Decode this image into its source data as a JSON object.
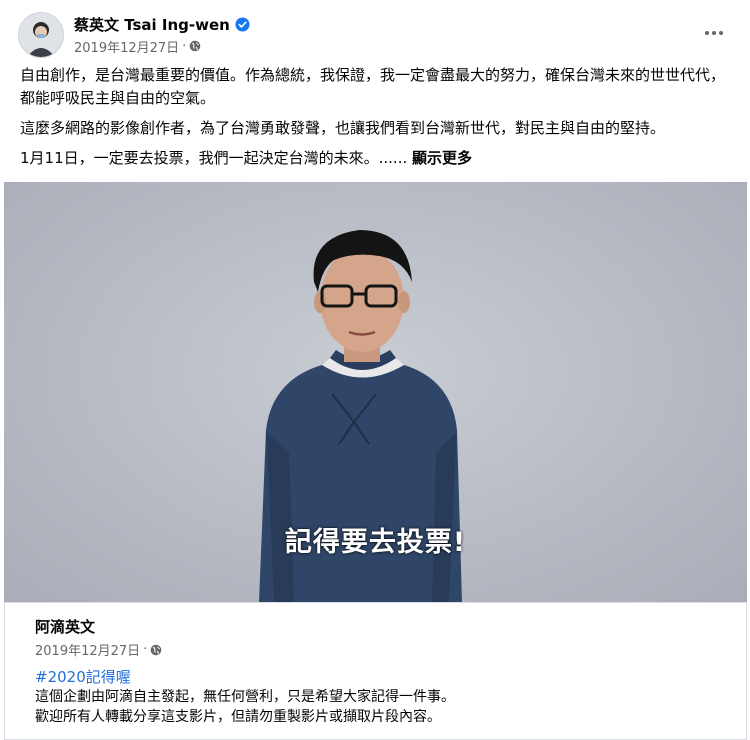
{
  "post": {
    "author": "蔡英文 Tsai Ing-wen",
    "date": "2019年12月27日",
    "separator": "·",
    "paragraphs": [
      "自由創作，是台灣最重要的價值。作為總統，我保證，我一定會盡最大的努力，確保台灣未來的世世代代，都能呼吸民主與自由的空氣。",
      "這麼多網路的影像創作者，為了台灣勇敢發聲，也讓我們看到台灣新世代，對民主與自由的堅持。",
      "1月11日，一定要去投票，我們一起決定台灣的未來。......"
    ],
    "see_more": "顯示更多"
  },
  "video": {
    "subtitle": "記得要去投票!"
  },
  "shared": {
    "page_name": "阿滴英文",
    "date": "2019年12月27日",
    "separator": "·",
    "hashtag": "#2020記得喔",
    "desc_lines": [
      "這個企劃由阿滴自主發起，無任何營利，只是希望大家記得一件事。",
      "歡迎所有人轉載分享這支影片，但請勿重製影片或擷取片段內容。"
    ]
  },
  "icons": {
    "verified": "verified-badge-icon",
    "globe": "globe-icon",
    "more": "more-options-icon"
  },
  "colors": {
    "link": "#216fdb",
    "verified": "#1877f2",
    "secondary_text": "#65676b"
  }
}
